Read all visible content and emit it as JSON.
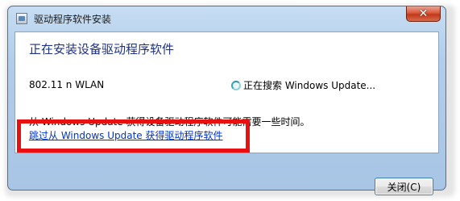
{
  "window": {
    "title": "驱动程序软件安装",
    "close_glyph": "✕"
  },
  "content": {
    "heading": "正在安装设备驱动程序软件",
    "device_name": "802.11 n WLAN",
    "status_text": "正在搜索 Windows Update...",
    "info_text": "从 Windows Update 获得设备驱动程序软件可能需要一些时间。",
    "skip_link": "跳过从 Windows Update 获得驱动程序软件"
  },
  "footer": {
    "close_button": "关闭(C)"
  },
  "colors": {
    "heading": "#1e3287",
    "link": "#0033cc",
    "highlight_box": "#e81010",
    "titlebar": "#b2cde9"
  }
}
